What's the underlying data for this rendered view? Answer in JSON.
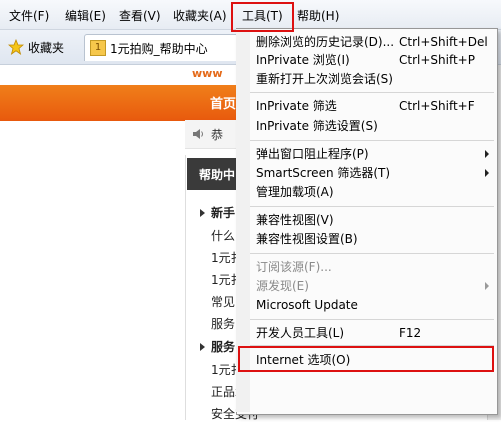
{
  "menubar": {
    "file": "文件(F)",
    "edit": "编辑(E)",
    "view": "查看(V)",
    "favorites": "收藏夹(A)",
    "tools": "工具(T)",
    "help": "帮助(H)"
  },
  "favbar": {
    "favorites_button": "收藏夹",
    "tab_icon_text": "1",
    "tab_title": "1元拍购_帮助中心"
  },
  "page": {
    "logo_fragment": "www",
    "home_link": "首页",
    "notice_fragment": "恭",
    "help_header": "帮助中",
    "left_items": [
      "新手",
      "什么",
      "1元扌",
      "1元扌",
      "常见",
      "服务",
      "服务",
      "1元扌",
      "正品承诺",
      "安全支付"
    ]
  },
  "tools_menu": {
    "items": [
      {
        "label": "删除浏览的历史记录(D)...",
        "shortcut": "Ctrl+Shift+Del"
      },
      {
        "label": "InPrivate 浏览(I)",
        "shortcut": "Ctrl+Shift+P"
      },
      {
        "label": "重新打开上次浏览会话(S)",
        "shortcut": ""
      },
      {
        "label": "InPrivate 筛选",
        "shortcut": "Ctrl+Shift+F"
      },
      {
        "label": "InPrivate 筛选设置(S)",
        "shortcut": ""
      },
      {
        "label": "弹出窗口阻止程序(P)",
        "shortcut": ""
      },
      {
        "label": "SmartScreen 筛选器(T)",
        "shortcut": ""
      },
      {
        "label": "管理加载项(A)",
        "shortcut": ""
      },
      {
        "label": "兼容性视图(V)",
        "shortcut": ""
      },
      {
        "label": "兼容性视图设置(B)",
        "shortcut": ""
      },
      {
        "label": "订阅该源(F)...",
        "shortcut": ""
      },
      {
        "label": "源发现(E)",
        "shortcut": ""
      },
      {
        "label": "Microsoft Update",
        "shortcut": ""
      },
      {
        "label": "开发人员工具(L)",
        "shortcut": "F12"
      },
      {
        "label": "Internet 选项(O)",
        "shortcut": ""
      }
    ]
  },
  "colors": {
    "highlight": "#dd1111",
    "orange_bar": "#ec6a14",
    "help_header_bg": "#3a3a3a"
  }
}
